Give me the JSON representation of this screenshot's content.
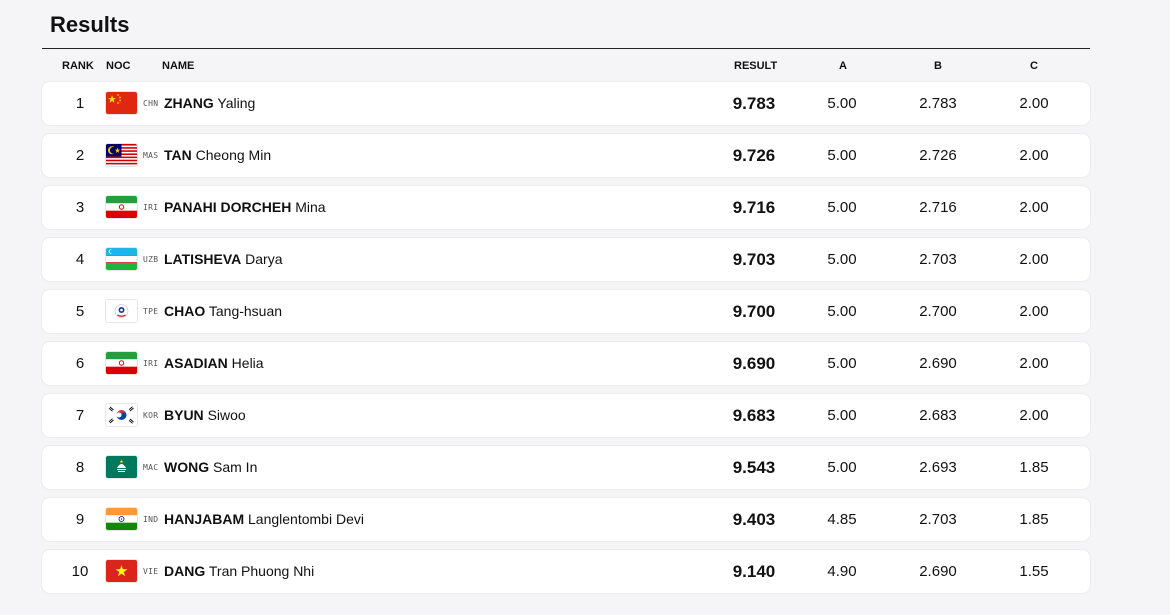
{
  "title": "Results",
  "columns": {
    "rank": "RANK",
    "noc": "NOC",
    "name": "NAME",
    "result": "RESULT",
    "a": "A",
    "b": "B",
    "c": "C"
  },
  "rows": [
    {
      "rank": "1",
      "noc": "CHN",
      "flag": "china-flag-icon",
      "last": "ZHANG",
      "first": "Yaling",
      "result": "9.783",
      "a": "5.00",
      "b": "2.783",
      "c": "2.00"
    },
    {
      "rank": "2",
      "noc": "MAS",
      "flag": "malaysia-flag-icon",
      "last": "TAN",
      "first": "Cheong Min",
      "result": "9.726",
      "a": "5.00",
      "b": "2.726",
      "c": "2.00"
    },
    {
      "rank": "3",
      "noc": "IRI",
      "flag": "iran-flag-icon",
      "last": "PANAHI DORCHEH",
      "first": "Mina",
      "result": "9.716",
      "a": "5.00",
      "b": "2.716",
      "c": "2.00"
    },
    {
      "rank": "4",
      "noc": "UZB",
      "flag": "uzbekistan-flag-icon",
      "last": "LATISHEVA",
      "first": "Darya",
      "result": "9.703",
      "a": "5.00",
      "b": "2.703",
      "c": "2.00"
    },
    {
      "rank": "5",
      "noc": "TPE",
      "flag": "chinese-taipei-flag-icon",
      "last": "CHAO",
      "first": "Tang-hsuan",
      "result": "9.700",
      "a": "5.00",
      "b": "2.700",
      "c": "2.00"
    },
    {
      "rank": "6",
      "noc": "IRI",
      "flag": "iran-flag-icon",
      "last": "ASADIAN",
      "first": "Helia",
      "result": "9.690",
      "a": "5.00",
      "b": "2.690",
      "c": "2.00"
    },
    {
      "rank": "7",
      "noc": "KOR",
      "flag": "korea-flag-icon",
      "last": "BYUN",
      "first": "Siwoo",
      "result": "9.683",
      "a": "5.00",
      "b": "2.683",
      "c": "2.00"
    },
    {
      "rank": "8",
      "noc": "MAC",
      "flag": "macau-flag-icon",
      "last": "WONG",
      "first": "Sam In",
      "result": "9.543",
      "a": "5.00",
      "b": "2.693",
      "c": "1.85"
    },
    {
      "rank": "9",
      "noc": "IND",
      "flag": "india-flag-icon",
      "last": "HANJABAM",
      "first": "Langlentombi Devi",
      "result": "9.403",
      "a": "4.85",
      "b": "2.703",
      "c": "1.85"
    },
    {
      "rank": "10",
      "noc": "VIE",
      "flag": "vietnam-flag-icon",
      "last": "DANG",
      "first": "Tran Phuong Nhi",
      "result": "9.140",
      "a": "4.90",
      "b": "2.690",
      "c": "1.55"
    }
  ],
  "colors": {
    "background": "#f5f5f7",
    "row_background": "#ffffff",
    "text": "#111111"
  }
}
